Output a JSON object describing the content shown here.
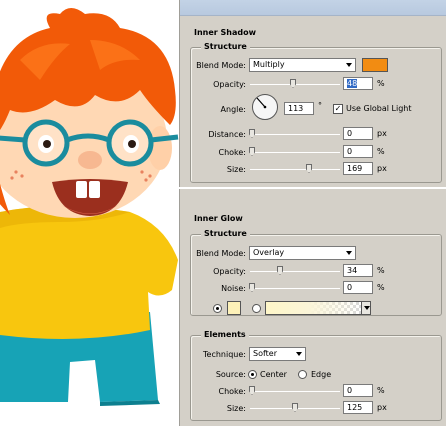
{
  "inner_shadow": {
    "title": "Inner Shadow",
    "structure_title": "Structure",
    "blend_mode_label": "Blend Mode:",
    "blend_mode_value": "Multiply",
    "color": "#f28c12",
    "opacity_label": "Opacity:",
    "opacity_value": "48",
    "opacity_percent": 48,
    "angle_label": "Angle:",
    "angle_value": "113",
    "angle_unit": "°",
    "use_global_light_label": "Use Global Light",
    "use_global_light_checked": true,
    "distance_label": "Distance:",
    "distance_value": "0",
    "distance_unit": "px",
    "choke_label": "Choke:",
    "choke_value": "0",
    "choke_unit": "%",
    "size_label": "Size:",
    "size_value": "169",
    "size_unit": "px",
    "percent_unit": "%"
  },
  "inner_glow": {
    "title": "Inner Glow",
    "structure_title": "Structure",
    "blend_mode_label": "Blend Mode:",
    "blend_mode_value": "Overlay",
    "opacity_label": "Opacity:",
    "opacity_value": "34",
    "opacity_percent": 34,
    "noise_label": "Noise:",
    "noise_value": "0",
    "percent_unit": "%",
    "color": "#fdf1b8",
    "elements_title": "Elements",
    "technique_label": "Technique:",
    "technique_value": "Softer",
    "source_label": "Source:",
    "source_center_label": "Center",
    "source_edge_label": "Edge",
    "choke_label": "Choke:",
    "choke_value": "0",
    "size_label": "Size:",
    "size_value": "125",
    "size_unit": "px"
  },
  "illustration": {
    "hair_color": "#f25a08",
    "skin_color": "#ffd8b4",
    "shirt_color": "#f8c60e",
    "pants_color": "#17a3b6",
    "glasses_color": "#1a8c9e"
  }
}
